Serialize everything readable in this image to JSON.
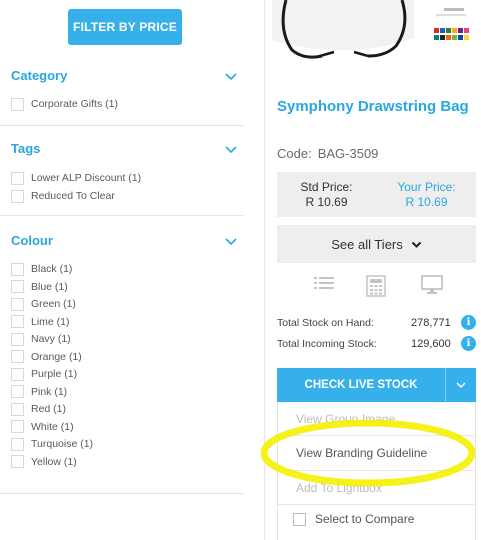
{
  "filter": {
    "button_label": "FILTER BY PRICE",
    "sections": [
      {
        "title": "Category",
        "options": [
          "Corporate Gifts (1)"
        ]
      },
      {
        "title": "Tags",
        "options": [
          "Lower ALP Discount (1)",
          "Reduced To Clear"
        ]
      },
      {
        "title": "Colour",
        "options": [
          "Black (1)",
          "Blue (1)",
          "Green (1)",
          "Lime (1)",
          "Navy (1)",
          "Orange (1)",
          "Purple (1)",
          "Pink (1)",
          "Red (1)",
          "White (1)",
          "Turquoise (1)",
          "Yellow (1)"
        ]
      }
    ]
  },
  "product": {
    "title": "Symphony Drawstring Bag",
    "code_label": "Code:",
    "code": "BAG-3509",
    "std_price_label": "Std Price:",
    "std_price": "R 10.69",
    "your_price_label": "Your Price:",
    "your_price": "R 10.69",
    "tiers_label": "See all Tiers",
    "stock_on_hand_label": "Total Stock on Hand:",
    "stock_on_hand": "278,771",
    "incoming_stock_label": "Total Incoming Stock:",
    "incoming_stock": "129,600",
    "info_glyph": "i",
    "check_stock_label": "CHECK LIVE STOCK",
    "menu": {
      "view_group_image": "View Group Image",
      "view_branding_guideline": "View Branding Guideline",
      "add_to_lightbox": "Add To Lightbox",
      "select_to_compare": "Select to Compare"
    },
    "icons": [
      "list-icon",
      "calculator-icon",
      "monitor-icon"
    ]
  },
  "colors": {
    "accent": "#35b0ea",
    "heading": "#2aa7e0",
    "highlight": "#f4f000"
  }
}
